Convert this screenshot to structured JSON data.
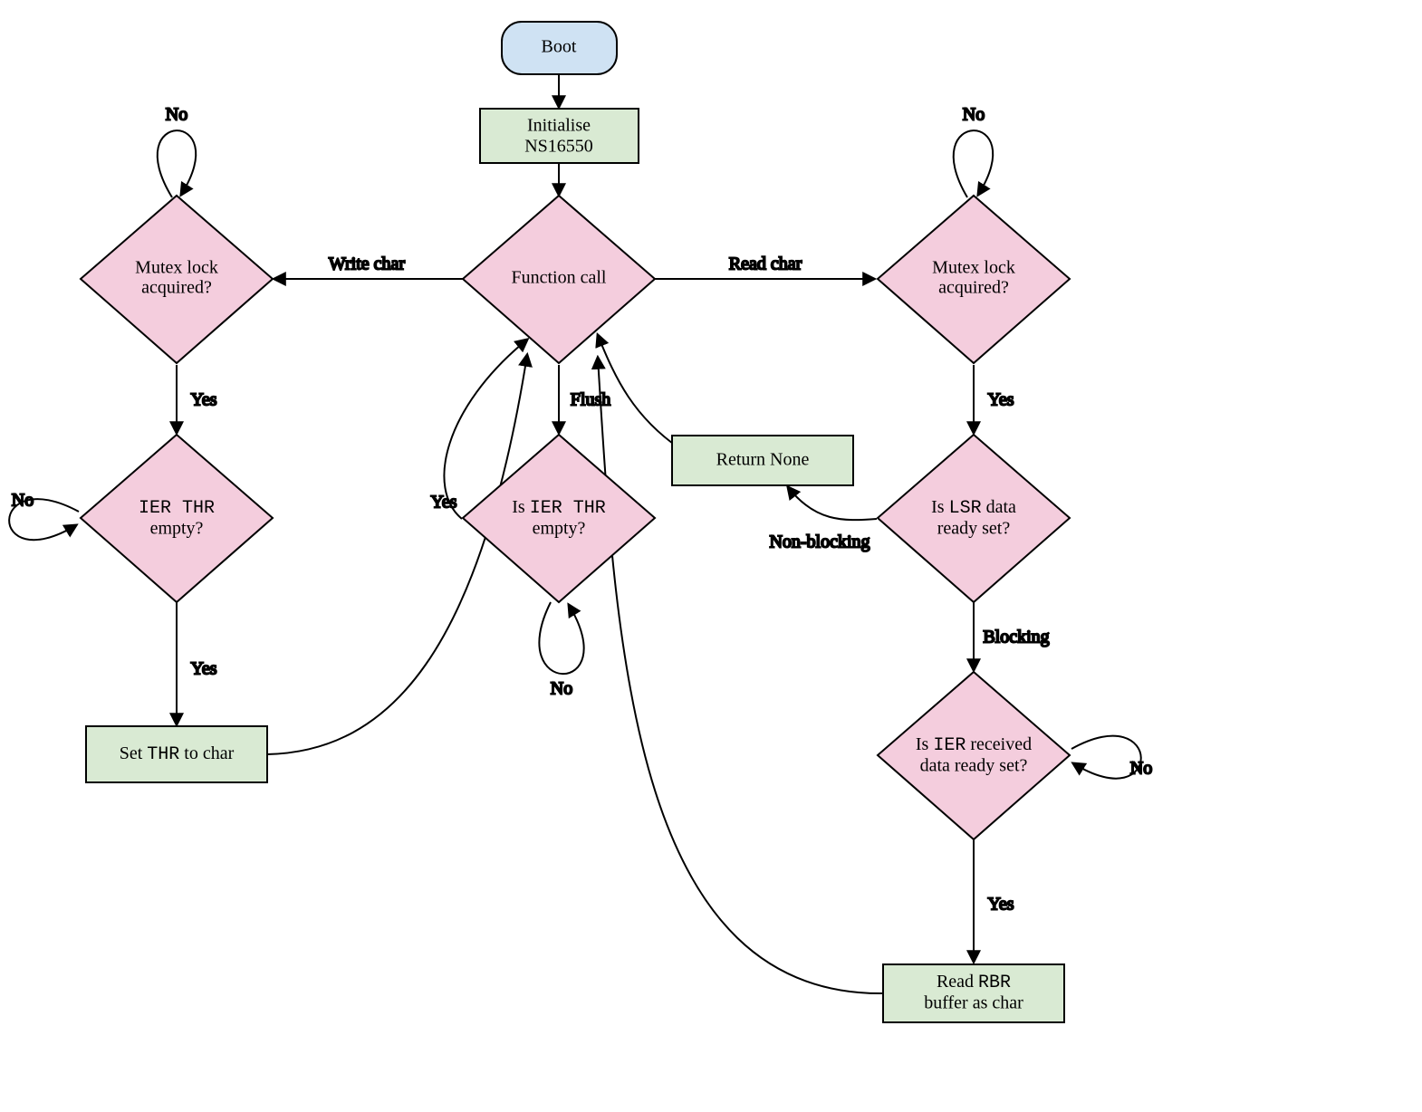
{
  "nodes": {
    "boot": "Boot",
    "init_l1": "Initialise",
    "init_l2": "NS16550",
    "func": "Function call",
    "mutexL_l1": "Mutex lock",
    "mutexL_l2": "acquired?",
    "mutexR_l1": "Mutex lock",
    "mutexR_l2": "acquired?",
    "ierL_pre": "IER THR",
    "ierL_l2": "empty?",
    "ierC_pre": "Is ",
    "ierC_mono": "IER THR",
    "ierC_l2": "empty?",
    "lsr_pre": "Is ",
    "lsr_mono": "LSR",
    "lsr_post": " data",
    "lsr_l2": "ready set?",
    "ierR_pre": "Is ",
    "ierR_mono": "IER",
    "ierR_post": " received",
    "ierR_l2": "data ready set?",
    "setthr_pre": "Set ",
    "setthr_mono": "THR",
    "setthr_post": " to char",
    "retnone": "Return None",
    "rbr_pre": "Read ",
    "rbr_mono": "RBR",
    "rbr_l2": "buffer as char"
  },
  "labels": {
    "write": "Write char",
    "read": "Read char",
    "flush": "Flush",
    "yes": "Yes",
    "no": "No",
    "nonblocking": "Non-blocking",
    "blocking": "Blocking"
  },
  "colors": {
    "terminal_fill": "#cfe2f3",
    "process_fill": "#d9ead3",
    "decision_fill": "#f4cddd",
    "stroke": "#000000"
  }
}
